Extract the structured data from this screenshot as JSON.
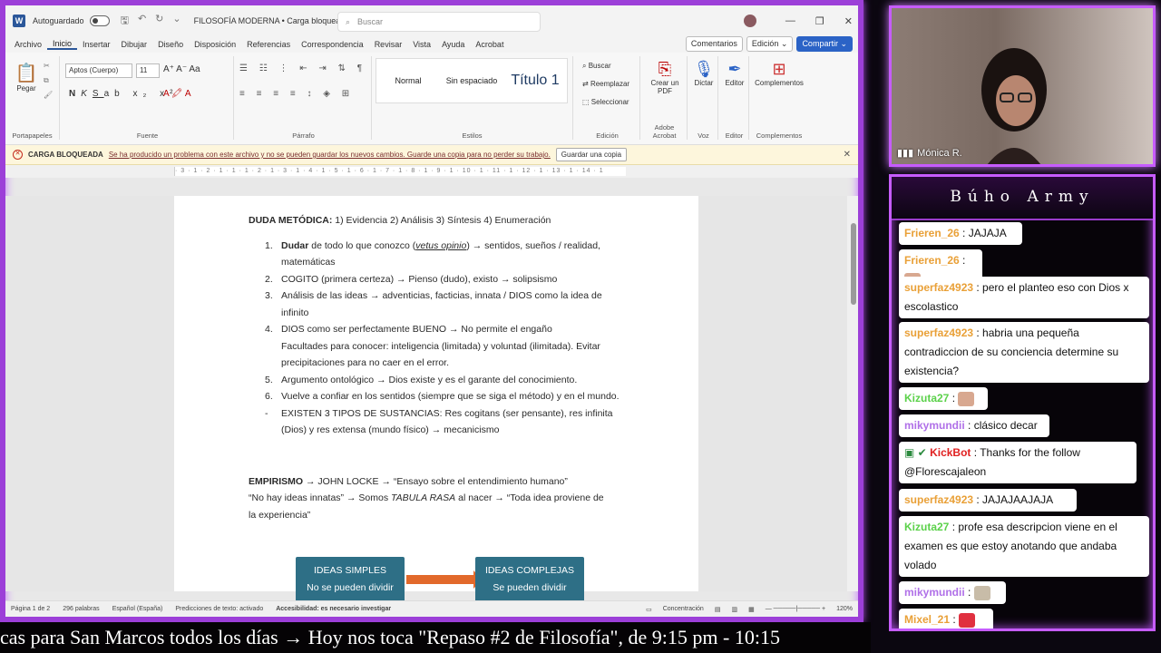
{
  "word": {
    "titlebar": {
      "autosave_label": "Autoguardado",
      "doc_title": "FILOSOFÍA MODERNA • Carga bloqueada ⌄",
      "search_placeholder": "Buscar"
    },
    "menu": {
      "items": [
        "Archivo",
        "Inicio",
        "Insertar",
        "Dibujar",
        "Diseño",
        "Disposición",
        "Referencias",
        "Correspondencia",
        "Revisar",
        "Vista",
        "Ayuda",
        "Acrobat"
      ],
      "active": "Inicio",
      "comments": "Comentarios",
      "editing": "Edición ⌄",
      "share": "Compartir ⌄"
    },
    "ribbon": {
      "paste": "Pegar",
      "font_name": "Aptos (Cuerpo)",
      "font_size": "11",
      "styles": [
        "Normal",
        "Sin espaciado",
        "Título 1"
      ],
      "find": "Buscar",
      "replace": "Reemplazar",
      "select": "Seleccionar",
      "create_pdf": "Crear un PDF",
      "dictate": "Dictar",
      "editor": "Editor",
      "addins": "Complementos",
      "groups": [
        "Portapapeles",
        "Fuente",
        "Párrafo",
        "Estilos",
        "Edición",
        "Adobe Acrobat",
        "Voz",
        "Editor",
        "Complementos"
      ]
    },
    "warning": {
      "title": "CARGA BLOQUEADA",
      "message": "Se ha producido un problema con este archivo y no se pueden guardar los nuevos cambios. Guarde una copia para no perder su trabajo.",
      "button": "Guardar una copia"
    },
    "ruler": "· 3 · 1 · 2 · 1 · 1 · 1 · 2 · 1 · 3 · 1 · 4 · 1 · 5 · 1 · 6 · 1 · 7 · 1 · 8 · 1 · 9 · 1 · 10 · 1 · 11 · 1 · 12 · 1 · 13 · 1 · 14 · 1",
    "document": {
      "heading1_bold": "DUDA METÓDICA:",
      "heading1_rest": " 1) Evidencia 2) Análisis 3) Síntesis 4) Enumeración",
      "items": [
        {
          "num": "1.",
          "bold": "Dudar",
          "pre": " de todo lo que conozco (",
          "italic": "vetus opinio",
          "post": ") → sentidos, sueños / realidad, matemáticas"
        },
        {
          "num": "2.",
          "text": "COGITO (primera certeza) → Pienso (dudo), existo → solipsismo"
        },
        {
          "num": "3.",
          "text": "Análisis de las ideas → adventicias, facticias, innata / DIOS como la idea de infinito"
        },
        {
          "num": "4.",
          "text": "DIOS como ser perfectamente BUENO → No permite el engaño",
          "extra": "Facultades para conocer: inteligencia (limitada) y voluntad (ilimitada). Evitar precipitaciones para no caer en el error."
        },
        {
          "num": "5.",
          "text": "Argumento ontológico → Dios existe y es el garante del conocimiento."
        },
        {
          "num": "6.",
          "text": "Vuelve a confiar en los sentidos (siempre que se siga el método) y en el mundo."
        },
        {
          "num": "-",
          "text": "EXISTEN 3 TIPOS DE SUSTANCIAS: Res cogitans (ser pensante), res infinita (Dios) y res extensa (mundo físico) → mecanicismo"
        }
      ],
      "empirismo_bold": "EMPIRISMO",
      "empirismo_rest": " → JOHN LOCKE → “Ensayo sobre el entendimiento humano”",
      "quote_pre": "“No hay ideas innatas” → Somos ",
      "quote_italic": "TABULA RASA",
      "quote_post": " al nacer → “Toda idea proviene de la experiencia”",
      "box1_title": "IDEAS SIMPLES",
      "box1_sub": "No se pueden dividir",
      "box2_title": "IDEAS COMPLEJAS",
      "box2_sub": "Se pueden dividir"
    },
    "status": {
      "page": "Página 1 de 2",
      "words": "296 palabras",
      "language": "Español (España)",
      "predictions": "Predicciones de texto: activado",
      "accessibility": "Accesibilidad: es necesario investigar",
      "focus": "Concentración",
      "zoom": "120%"
    }
  },
  "webcam": {
    "name": "Mónica R."
  },
  "chat": {
    "title": "Búho Army",
    "messages": [
      {
        "user": "Frieren_26",
        "color": "#e9a037",
        "text": " : JAJAJA"
      },
      {
        "user": "Frieren_26",
        "color": "#e9a037",
        "text": " : ",
        "emote": "emote-face"
      },
      {
        "user": "superfaz4923",
        "color": "#e9a037",
        "text": " : pero el planteo eso con Dios x escolastico"
      },
      {
        "user": "superfaz4923",
        "color": "#e9a037",
        "text": " : habria una pequeña contradiccion de su conciencia determine su existencia?"
      },
      {
        "user": "Kizuta27",
        "color": "#5bd14a",
        "text": " : ",
        "emote": "emote-face"
      },
      {
        "user": "mikymundii",
        "color": "#b070e8",
        "text": " : clásico decar"
      },
      {
        "user": "KickBot",
        "color": "#e02020",
        "text": " : Thanks for the follow @Florescajaleon"
      },
      {
        "user": "superfaz4923",
        "color": "#e9a037",
        "text": " : JAJAJAAJAJA"
      },
      {
        "user": "Kizuta27",
        "color": "#5bd14a",
        "text": " : profe esa descripcion viene en el examen es que estoy anotando que andaba volado"
      },
      {
        "user": "mikymundii",
        "color": "#b070e8",
        "text": " : ",
        "emote": "emote-cat"
      },
      {
        "user": "Mixel_21",
        "color": "#e9a037",
        "text": " : ",
        "emote": "emote-red"
      }
    ]
  },
  "ticker": {
    "text": "cas para San Marcos todos los días  →  Hoy nos toca \"Repaso #2 de Filosofía\", de 9:15 pm - 10:15"
  }
}
